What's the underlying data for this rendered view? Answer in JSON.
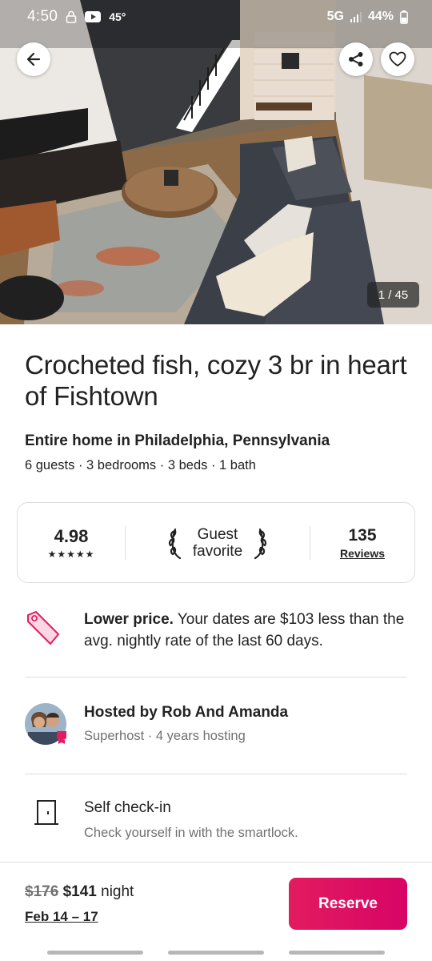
{
  "status_bar": {
    "time": "4:50",
    "temperature": "45°",
    "network": "5G",
    "battery": "44%"
  },
  "gallery": {
    "counter": "1 / 45",
    "icons": [
      "back-arrow-icon",
      "share-icon",
      "heart-icon"
    ]
  },
  "listing": {
    "title": "Crocheted fish, cozy 3 br in heart of Fishtown",
    "subtitle": "Entire home in Philadelphia, Pennsylvania",
    "specs": "6 guests · 3 bedrooms · 3 beds · 1 bath"
  },
  "rating_card": {
    "score": "4.98",
    "stars": "★★★★★",
    "badge_line1": "Guest",
    "badge_line2": "favorite",
    "review_count": "135",
    "review_label": "Reviews"
  },
  "price_notice": {
    "bold": "Lower price.",
    "text": " Your dates are $103 less than the avg. nightly rate of the last 60 days."
  },
  "host": {
    "name": "Hosted by Rob And Amanda",
    "details": "Superhost · 4 years hosting"
  },
  "highlight": {
    "title": "Self check-in",
    "text": "Check yourself in with the smartlock."
  },
  "footer": {
    "old_price": "$176",
    "new_price": "$141",
    "unit": "night",
    "dates": "Feb 14 – 17",
    "reserve_label": "Reserve"
  },
  "colors": {
    "brand": "#e31c5f",
    "text": "#222222",
    "muted": "#717171",
    "divider": "#dddddd"
  }
}
